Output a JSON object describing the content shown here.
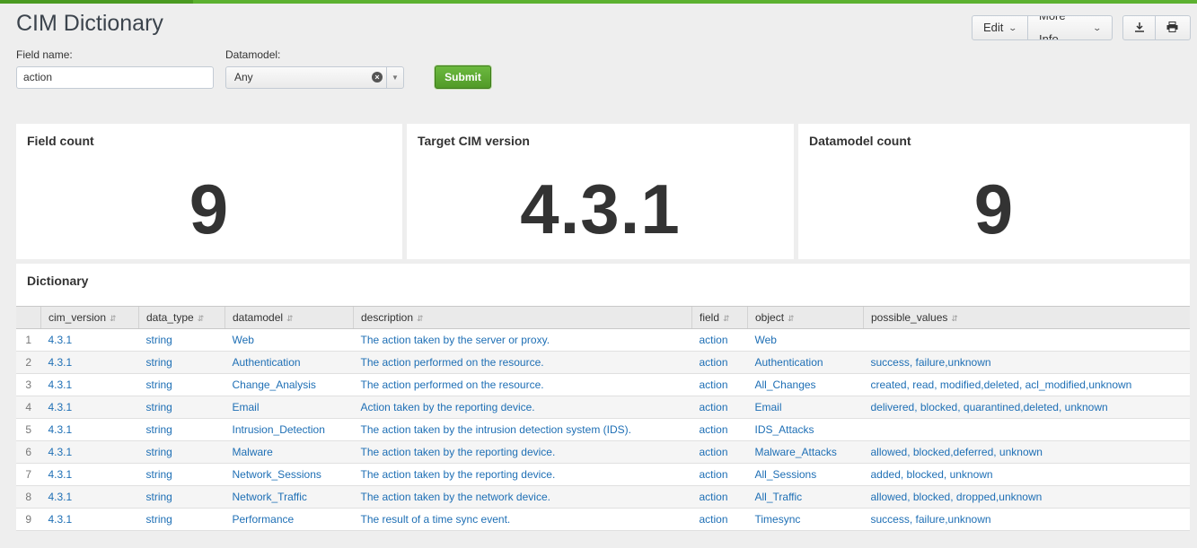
{
  "header": {
    "title": "CIM Dictionary",
    "edit_label": "Edit",
    "more_info_label": "More Info",
    "download_icon": "download-icon",
    "print_icon": "print-icon"
  },
  "inputs": {
    "field_name_label": "Field name:",
    "field_name_value": "action",
    "datamodel_label": "Datamodel:",
    "datamodel_value": "Any",
    "submit_label": "Submit"
  },
  "panels": {
    "field_count": {
      "title": "Field count",
      "value": "9"
    },
    "cim_version": {
      "title": "Target CIM version",
      "value": "4.3.1"
    },
    "datamodel_count": {
      "title": "Datamodel count",
      "value": "9"
    }
  },
  "dictionary": {
    "title": "Dictionary",
    "columns": [
      "cim_version",
      "data_type",
      "datamodel",
      "description",
      "field",
      "object",
      "possible_values"
    ],
    "rows": [
      [
        "1",
        "4.3.1",
        "string",
        "Web",
        "The action taken by the server or proxy.",
        "action",
        "Web",
        ""
      ],
      [
        "2",
        "4.3.1",
        "string",
        "Authentication",
        "The action performed on the resource.",
        "action",
        "Authentication",
        "success, failure,unknown"
      ],
      [
        "3",
        "4.3.1",
        "string",
        "Change_Analysis",
        "The action performed on the resource.",
        "action",
        "All_Changes",
        "created, read, modified,deleted, acl_modified,unknown"
      ],
      [
        "4",
        "4.3.1",
        "string",
        "Email",
        "Action taken by the reporting device.",
        "action",
        "Email",
        "delivered, blocked, quarantined,deleted, unknown"
      ],
      [
        "5",
        "4.3.1",
        "string",
        "Intrusion_Detection",
        "The action taken by the intrusion detection system (IDS).",
        "action",
        "IDS_Attacks",
        ""
      ],
      [
        "6",
        "4.3.1",
        "string",
        "Malware",
        "The action taken by the reporting device.",
        "action",
        "Malware_Attacks",
        "allowed, blocked,deferred, unknown"
      ],
      [
        "7",
        "4.3.1",
        "string",
        "Network_Sessions",
        "The action taken by the reporting device.",
        "action",
        "All_Sessions",
        "added, blocked, unknown"
      ],
      [
        "8",
        "4.3.1",
        "string",
        "Network_Traffic",
        "The action taken by the network device.",
        "action",
        "All_Traffic",
        "allowed, blocked, dropped,unknown"
      ],
      [
        "9",
        "4.3.1",
        "string",
        "Performance",
        "The result of a time sync event.",
        "action",
        "Timesync",
        "success, failure,unknown"
      ]
    ]
  }
}
